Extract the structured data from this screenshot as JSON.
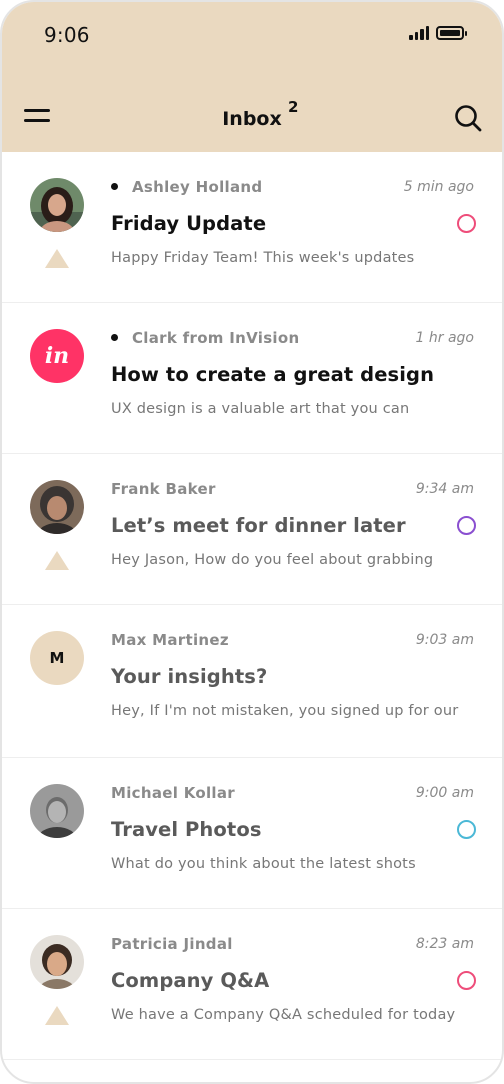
{
  "status": {
    "time": "9:06"
  },
  "header": {
    "title": "Inbox",
    "badge": "2"
  },
  "colors": {
    "header_bg": "#ead9c0",
    "accent_pink": "#ff3366"
  },
  "messages": [
    {
      "sender": "Ashley Holland",
      "time": "5 min ago",
      "subject": "Friday Update",
      "preview": "Happy Friday Team! This week's updates",
      "unread": true,
      "avatar": "photo",
      "flagged": true,
      "label_color": "#ee4d7a"
    },
    {
      "sender": "Clark from InVision",
      "time": "1 hr ago",
      "subject": "How to create a great design",
      "preview": "UX design is a valuable art that you can",
      "unread": true,
      "avatar": "invision",
      "avatar_text": "in",
      "flagged": false
    },
    {
      "sender": "Frank Baker",
      "time": "9:34 am",
      "subject": "Let’s meet for dinner later",
      "preview": "Hey Jason, How do you feel about grabbing",
      "unread": false,
      "avatar": "photo",
      "flagged": true,
      "label_color": "#8a4fd0"
    },
    {
      "sender": "Max Martinez",
      "time": "9:03 am",
      "subject": "Your insights?",
      "preview": "Hey, If I'm not mistaken, you signed up for our",
      "unread": false,
      "avatar": "letter",
      "avatar_text": "M",
      "flagged": false
    },
    {
      "sender": "Michael Kollar",
      "time": "9:00 am",
      "subject": "Travel Photos",
      "preview": "What do you think about the latest shots",
      "unread": false,
      "avatar": "photo",
      "flagged": false,
      "label_color": "#4bb8d6"
    },
    {
      "sender": "Patricia Jindal",
      "time": "8:23 am",
      "subject": "Company Q&A",
      "preview": "We have a Company Q&A scheduled for today",
      "unread": false,
      "avatar": "photo",
      "flagged": true,
      "label_color": "#ee4d7a"
    }
  ]
}
